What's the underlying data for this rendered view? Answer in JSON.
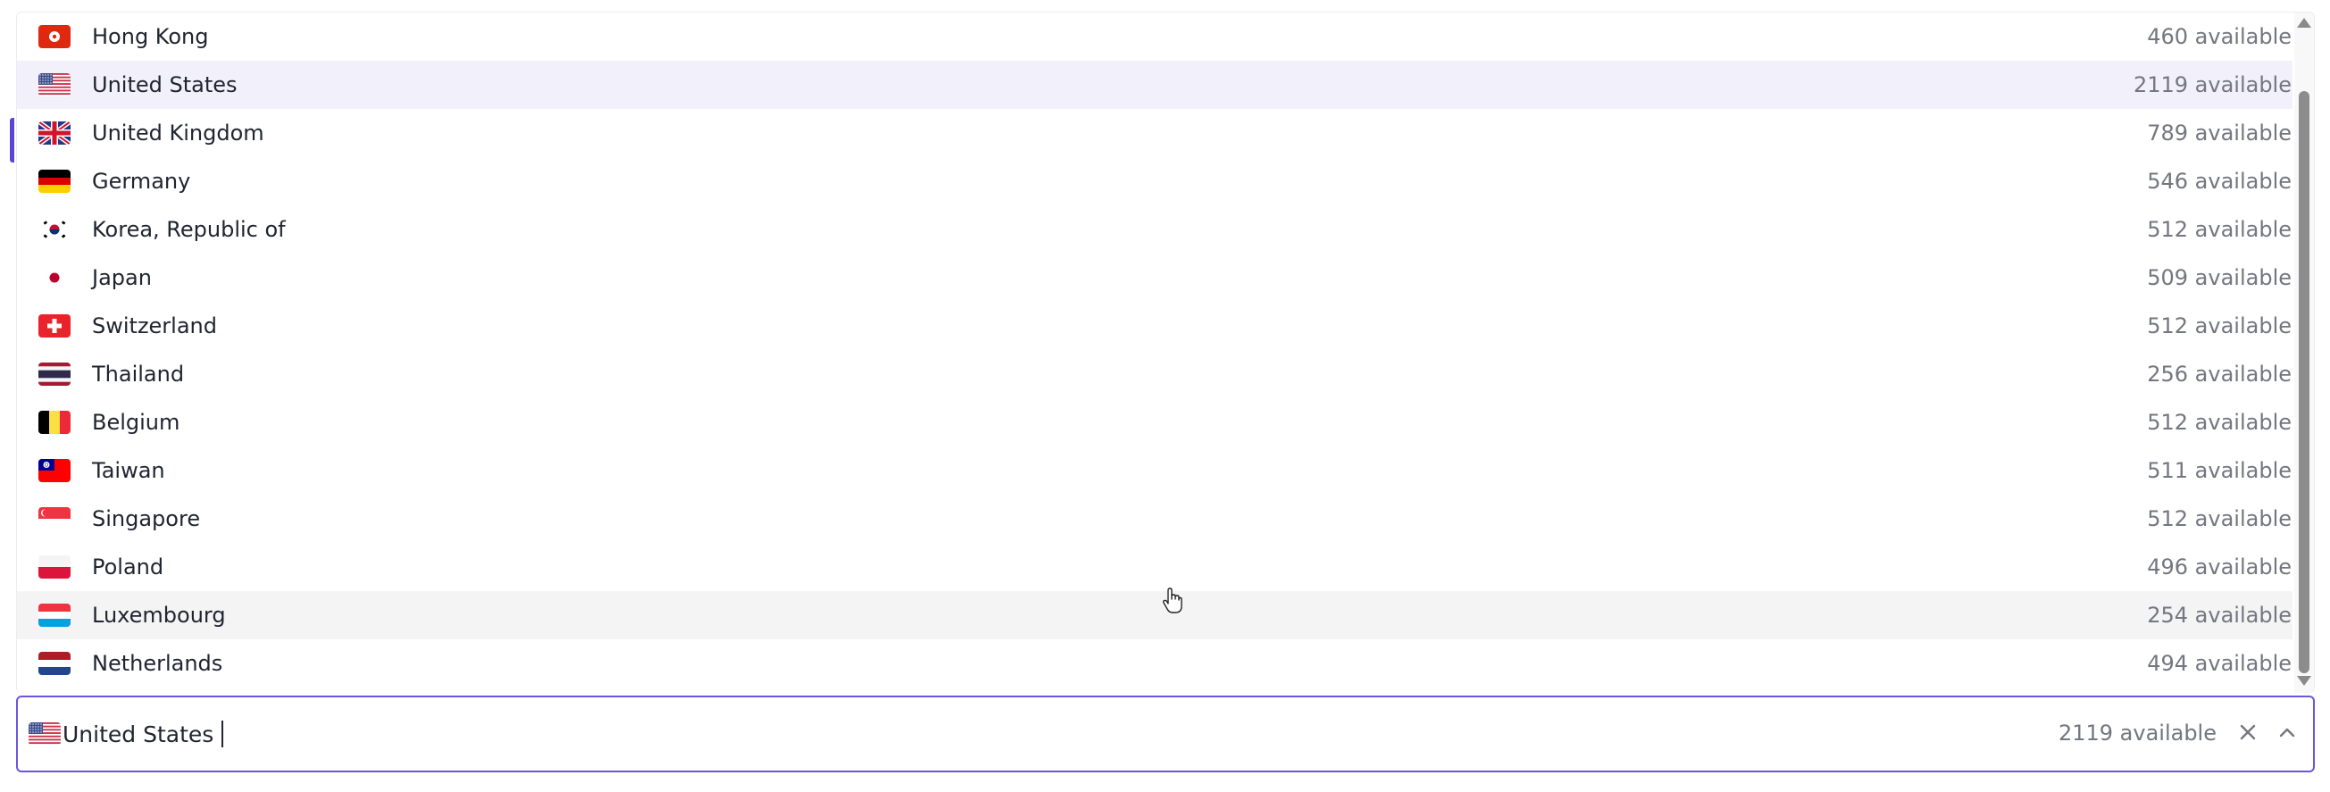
{
  "countries": [
    {
      "name": "Hong Kong",
      "available": "460 available",
      "flag": "hk-flag-icon"
    },
    {
      "name": "United States",
      "available": "2119 available",
      "flag": "us-flag-icon"
    },
    {
      "name": "United Kingdom",
      "available": "789 available",
      "flag": "uk-flag-icon"
    },
    {
      "name": "Germany",
      "available": "546 available",
      "flag": "de-flag-icon"
    },
    {
      "name": "Korea, Republic of",
      "available": "512 available",
      "flag": "kr-flag-icon"
    },
    {
      "name": "Japan",
      "available": "509 available",
      "flag": "jp-flag-icon"
    },
    {
      "name": "Switzerland",
      "available": "512 available",
      "flag": "ch-flag-icon"
    },
    {
      "name": "Thailand",
      "available": "256 available",
      "flag": "th-flag-icon"
    },
    {
      "name": "Belgium",
      "available": "512 available",
      "flag": "be-flag-icon"
    },
    {
      "name": "Taiwan",
      "available": "511 available",
      "flag": "tw-flag-icon"
    },
    {
      "name": "Singapore",
      "available": "512 available",
      "flag": "sg-flag-icon"
    },
    {
      "name": "Poland",
      "available": "496 available",
      "flag": "pl-flag-icon"
    },
    {
      "name": "Luxembourg",
      "available": "254 available",
      "flag": "lu-flag-icon"
    },
    {
      "name": "Netherlands",
      "available": "494 available",
      "flag": "nl-flag-icon"
    }
  ],
  "selected_index": 1,
  "hovered_index": 12,
  "combobox": {
    "value": "United States",
    "available": "2119 available",
    "flag": "us-flag-icon"
  },
  "colors": {
    "accent": "#5b45d6",
    "selected_row": "#f2f1fb",
    "hovered_row": "#f4f4f4",
    "muted_text": "#747680"
  }
}
